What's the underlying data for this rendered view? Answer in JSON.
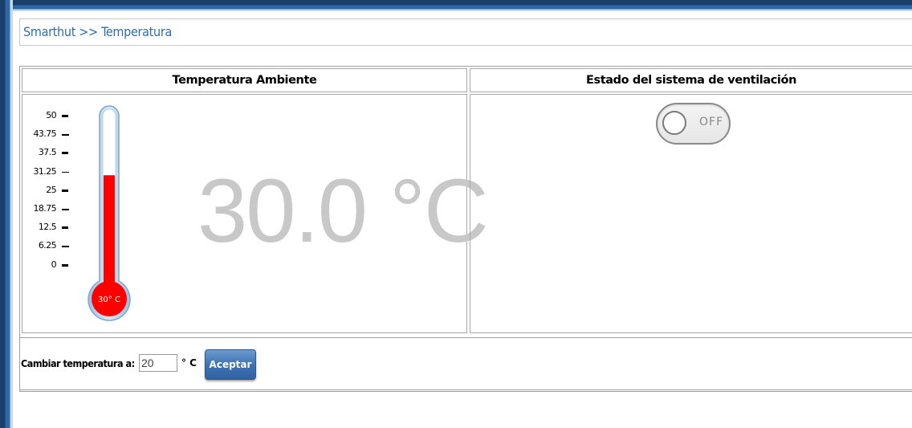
{
  "breadcrumb": "Smarthut >> Temperatura",
  "temperature_panel": {
    "header": "Temperatura Ambiente",
    "value_display": "30.0 °C",
    "bulb_label": "30° C",
    "current_value": 30,
    "max_value": 50,
    "scale_labels": [
      "50",
      "43.75",
      "37.5",
      "31.25",
      "25",
      "18.75",
      "12.5",
      "6.25",
      "0"
    ],
    "fill_color": "#ff0000",
    "display_color": "#c8c8c8"
  },
  "ventilation_panel": {
    "header": "Estado del sistema de ventilación",
    "toggle_state": "OFF"
  },
  "form": {
    "label": "Cambiar temperatura a:",
    "input_value": "20",
    "unit": "° C",
    "button_label": "Aceptar"
  },
  "colors": {
    "link": "#2e6db0",
    "button": "#3f74b1"
  }
}
